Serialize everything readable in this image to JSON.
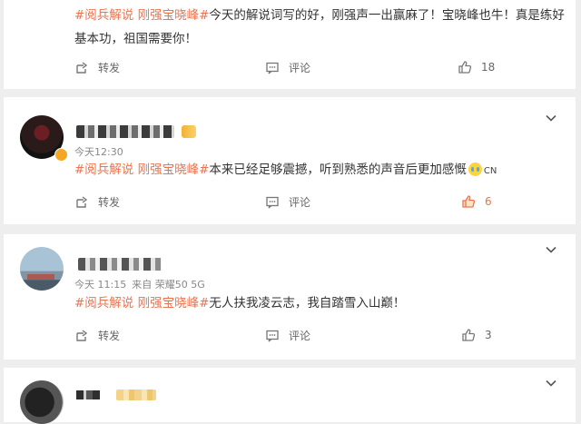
{
  "comments": [
    {
      "text_tag": "#阅兵解说 刚强宝晓峰#",
      "text_body": "今天的解说词写的好，刚强声一出赢麻了！宝晓峰也牛！真是练好基本功，祖国需要你！",
      "repost_label": "转发",
      "comment_label": "评论",
      "likes": "18",
      "liked": false
    },
    {
      "time": "今天12:30",
      "text_tag": "#阅兵解说 刚强宝晓峰#",
      "text_body": "本来已经足够震撼，听到熟悉的声音后更加感慨",
      "emoji": "cry-icon",
      "emoji_suffix": "CN",
      "repost_label": "转发",
      "comment_label": "评论",
      "likes": "6",
      "liked": true
    },
    {
      "time": "今天 11:15",
      "source": "来自 荣耀50 5G",
      "text_tag": "#阅兵解说 刚强宝晓峰#",
      "text_body": "无人扶我凌云志，我自踏雪入山巅！",
      "repost_label": "转发",
      "comment_label": "评论",
      "likes": "3",
      "liked": false
    }
  ],
  "colors": {
    "tag": "#eb7350",
    "liked": "#eb7350",
    "background": "#eeeeee"
  },
  "icons": [
    "repost-icon",
    "comment-icon",
    "like-icon",
    "chevron-down-icon",
    "verified-icon"
  ]
}
